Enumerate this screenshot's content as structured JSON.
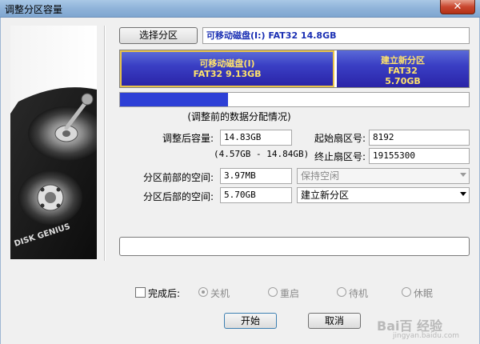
{
  "window": {
    "title": "调整分区容量",
    "close_glyph": "✕"
  },
  "select_button": "选择分区",
  "partition_label": "可移动磁盘(I:) FAT32 14.8GB",
  "partition_bar": {
    "segments": [
      {
        "name": "可移动磁盘(I)",
        "fs": "FAT32 9.13GB",
        "size": ""
      },
      {
        "name": "建立新分区",
        "fs": "FAT32",
        "size": "5.70GB"
      }
    ],
    "split_fraction": 0.616
  },
  "usage_fill_fraction": 0.31,
  "caption": "(调整前的数据分配情况)",
  "form": {
    "size_after_label": "调整后容量:",
    "size_after_value": "14.83GB",
    "size_range": "(4.57GB - 14.84GB)",
    "start_sector_label": "起始扇区号:",
    "start_sector_value": "8192",
    "end_sector_label": "终止扇区号:",
    "end_sector_value": "19155300",
    "space_before_label": "分区前部的空间:",
    "space_before_value": "3.97MB",
    "space_before_action": "保持空闲",
    "space_after_label": "分区后部的空间:",
    "space_after_value": "5.70GB",
    "space_after_action": "建立新分区"
  },
  "completion": {
    "label": "完成后:",
    "options": [
      "关机",
      "重启",
      "待机",
      "休眠"
    ],
    "selected": "关机"
  },
  "buttons": {
    "start": "开始",
    "cancel": "取消"
  },
  "art": {
    "brand_text": "DISK GENIUS"
  },
  "watermark": {
    "text": "Bai百 经验",
    "url": "jingyan.baidu.com"
  }
}
